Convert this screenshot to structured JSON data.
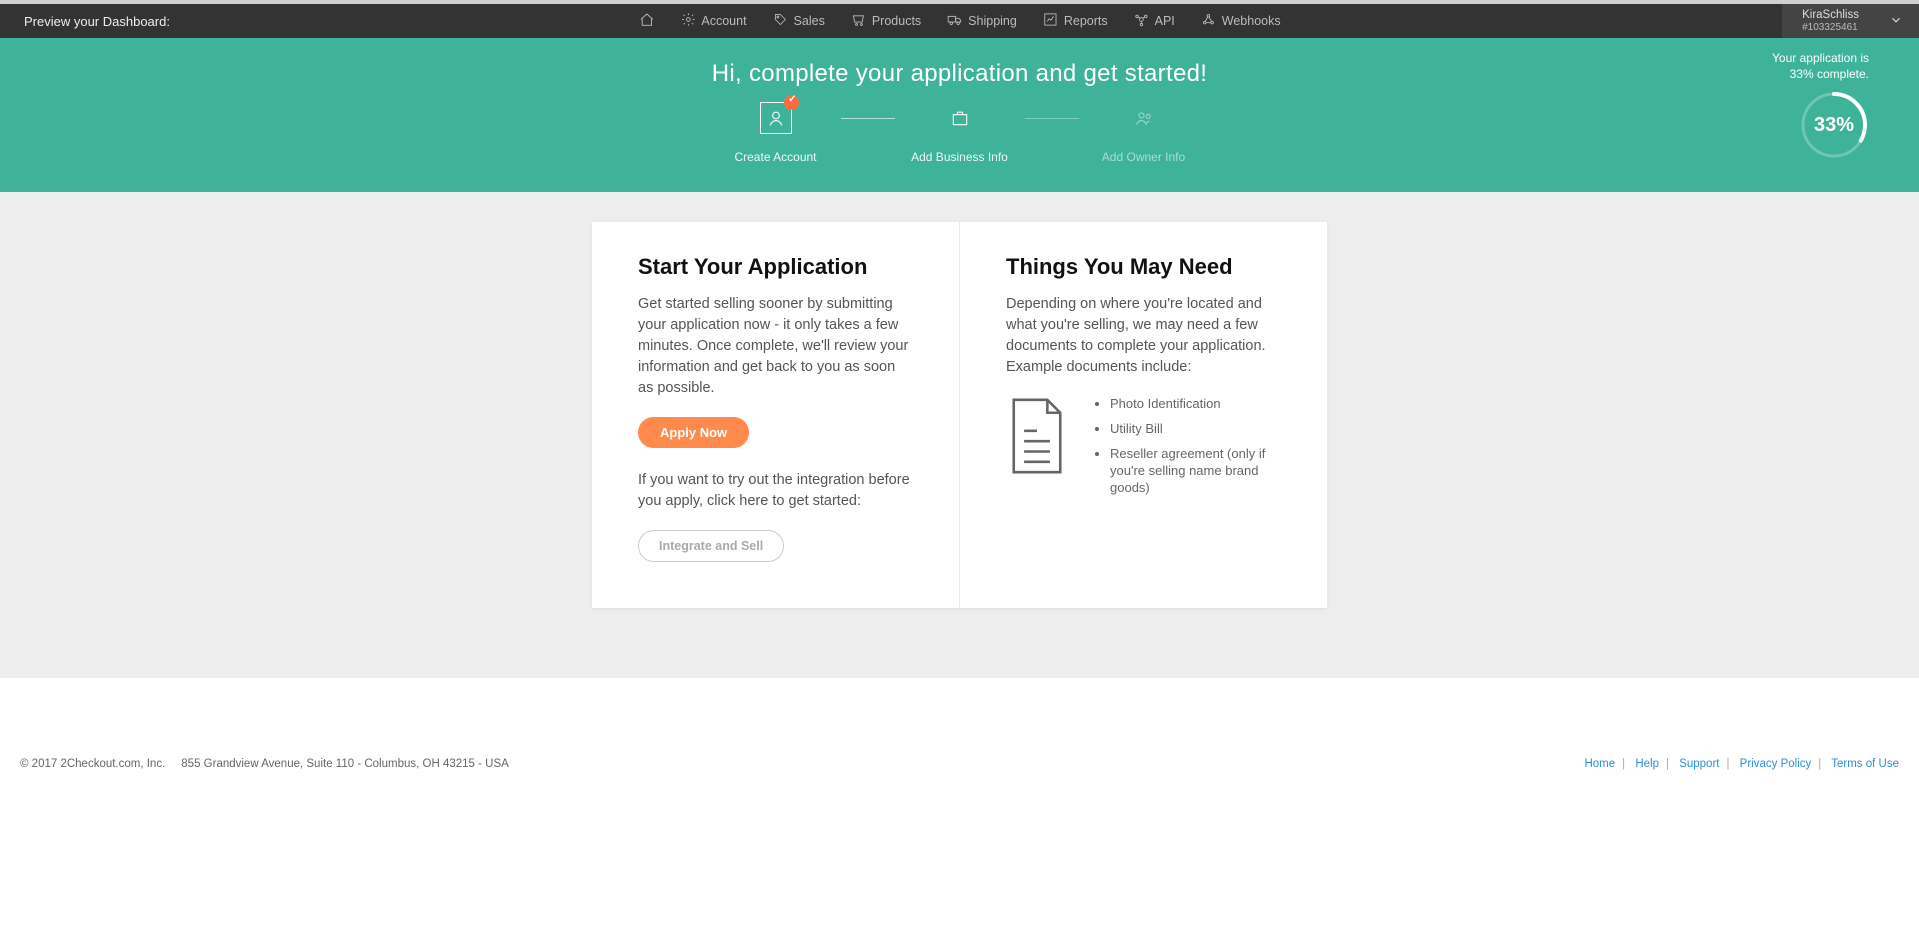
{
  "preview_label": "Preview your Dashboard:",
  "nav": {
    "account": "Account",
    "sales": "Sales",
    "products": "Products",
    "shipping": "Shipping",
    "reports": "Reports",
    "api": "API",
    "webhooks": "Webhooks"
  },
  "user": {
    "name": "KiraSchliss",
    "id": "#103325461"
  },
  "hero": {
    "title": "Hi, complete your application and get started!",
    "steps": {
      "create": "Create Account",
      "business": "Add Business Info",
      "owner": "Add Owner Info"
    },
    "progress_pct": "33%",
    "progress_line1": "Your application is",
    "progress_line2_pct": "33%",
    "progress_line2_rest": " complete."
  },
  "left_card": {
    "title": "Start Your Application",
    "para1": "Get started selling sooner by submitting your application now - it only takes a few minutes. Once complete, we'll review your information and get back to you as soon as possible.",
    "apply_btn": "Apply Now",
    "para2": "If you want to try out the integration before you apply, click here to get started:",
    "integrate_btn": "Integrate and Sell"
  },
  "right_card": {
    "title": "Things You May Need",
    "para": "Depending on where you're located and what you're selling, we may need a few documents to complete your application. Example documents include:",
    "items": [
      "Photo Identification",
      "Utility Bill",
      "Reseller agreement (only if you're selling name brand goods)"
    ]
  },
  "footer": {
    "copyright": "© 2017 2Checkout.com, Inc.",
    "address": "855 Grandview Avenue, Suite 110  -  Columbus, OH 43215  -  USA",
    "links": {
      "home": "Home",
      "help": "Help",
      "support": "Support",
      "privacy": "Privacy Policy",
      "terms": "Terms of Use"
    }
  }
}
